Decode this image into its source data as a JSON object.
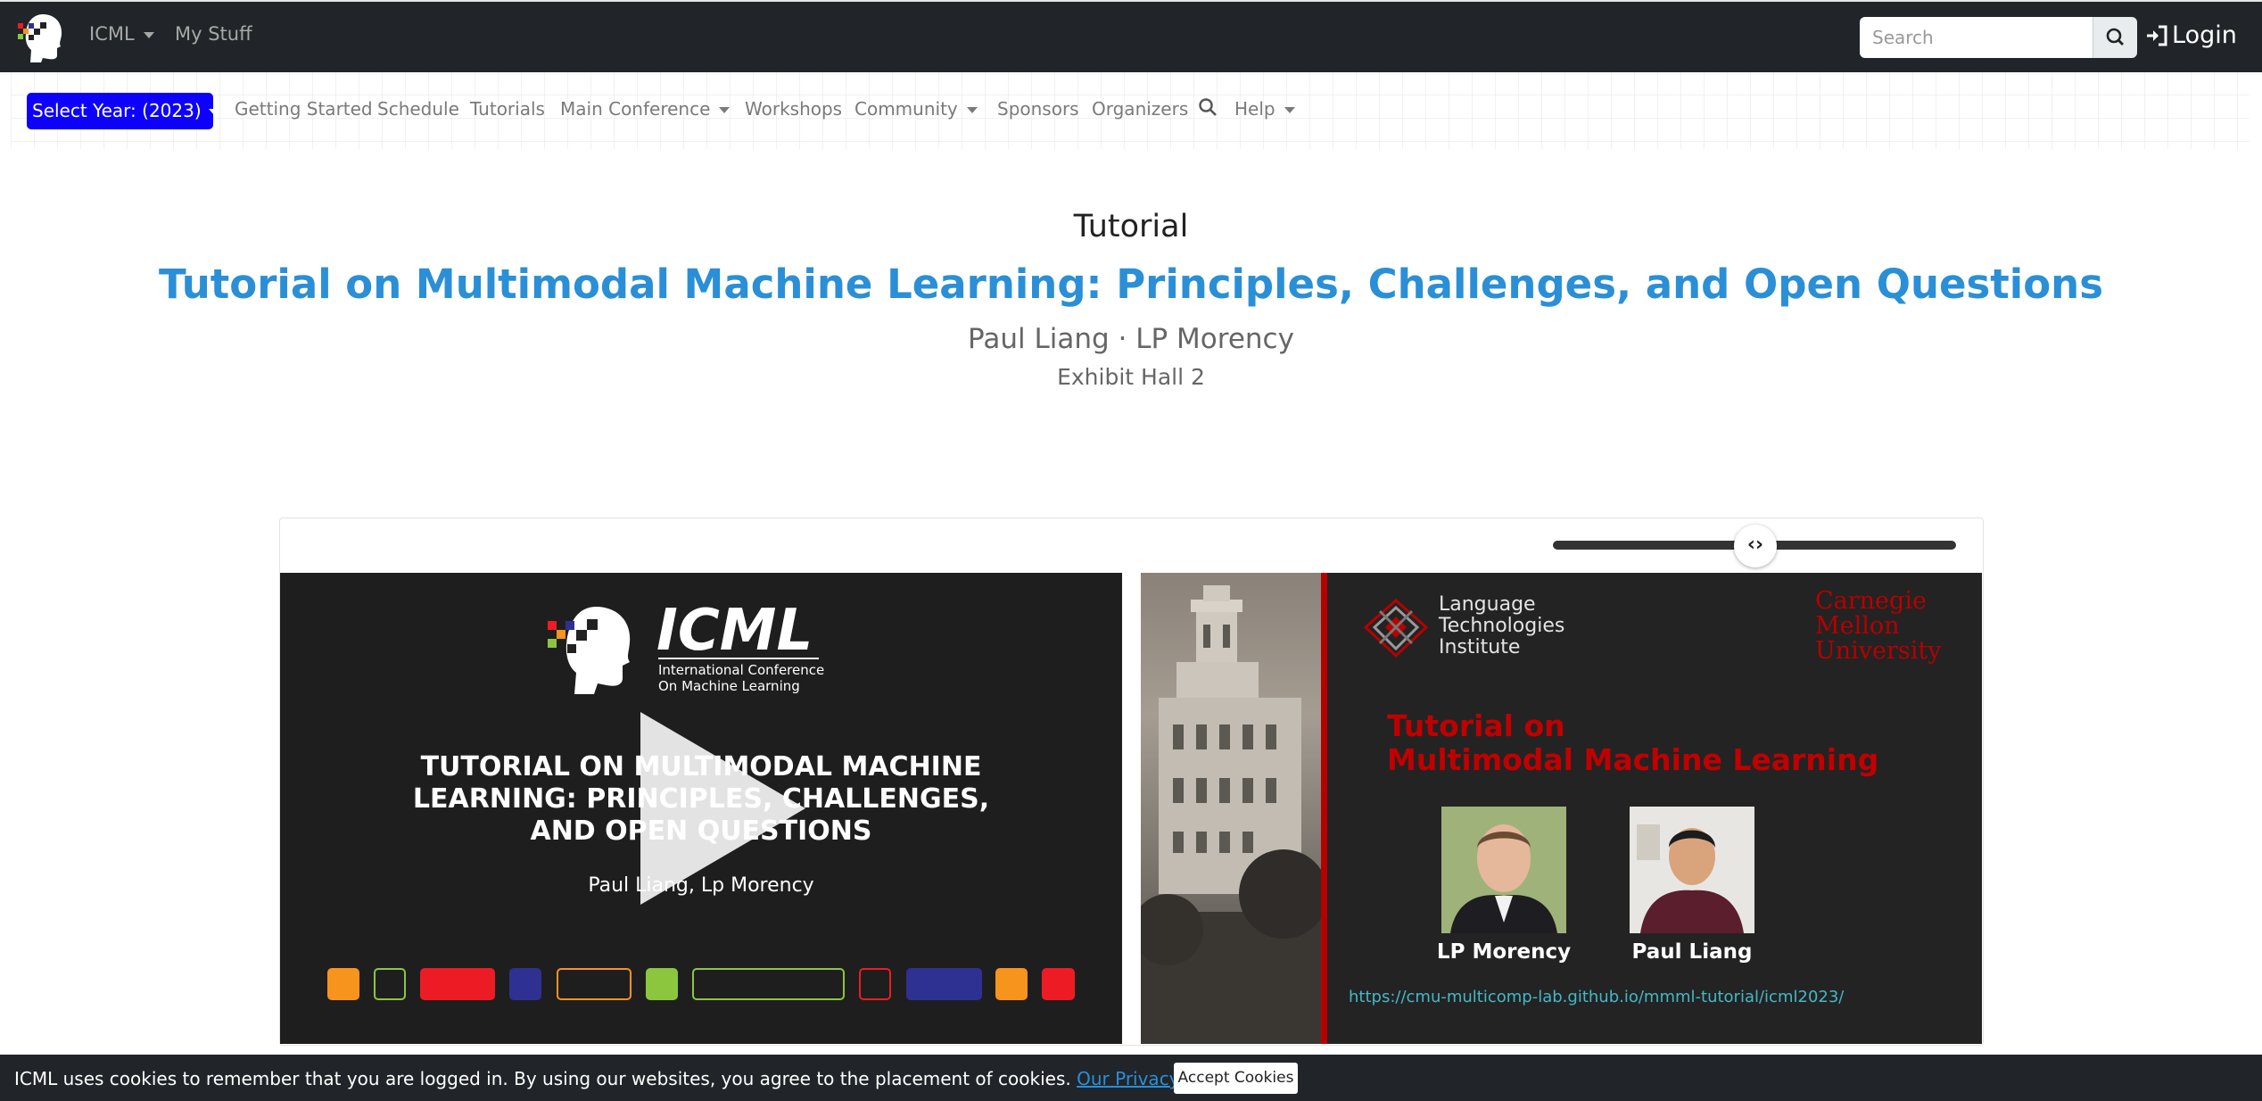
{
  "topnav": {
    "brand_label": "ICML",
    "my_stuff": "My Stuff",
    "search_placeholder": "Search",
    "login": "Login"
  },
  "subnav": {
    "year_select": "Select Year: (2023)",
    "items": [
      "Getting Started",
      "Schedule",
      "Tutorials",
      "Main Conference",
      "Workshops",
      "Community",
      "Sponsors",
      "Organizers",
      "Help"
    ]
  },
  "event": {
    "kind": "Tutorial",
    "title": "Tutorial on Multimodal Machine Learning: Principles, Challenges, and Open Questions",
    "authors": "Paul Liang · LP Morency",
    "location": "Exhibit Hall 2"
  },
  "player": {
    "slider_glyph": "‹›",
    "left_slide": {
      "logo_word": "ICML",
      "logo_sub_1": "International Conference",
      "logo_sub_2": "On Machine Learning",
      "title": "TUTORIAL ON MULTIMODAL MACHINE LEARNING: PRINCIPLES, CHALLENGES, AND OPEN QUESTIONS",
      "names": "Paul Liang, Lp Morency",
      "colors": [
        "#f7941d",
        "#8cc63f",
        "#ed1c24",
        "#2e3192"
      ]
    },
    "right_slide": {
      "lti_1": "Language",
      "lti_2": "Technologies",
      "lti_3": "Institute",
      "cmu_1": "Carnegie",
      "cmu_2": "Mellon",
      "cmu_3": "University",
      "title_1": "Tutorial on",
      "title_2": "Multimodal Machine Learning",
      "person_1": "LP Morency",
      "person_2": "Paul Liang",
      "url": "https://cmu-multicomp-lab.github.io/mmml-tutorial/icml2023/"
    }
  },
  "cookie": {
    "text": "ICML uses cookies to remember that you are logged in. By using our websites, you agree to the placement of cookies. ",
    "link": "Our Privacy Policy »",
    "button": "Accept Cookies"
  }
}
